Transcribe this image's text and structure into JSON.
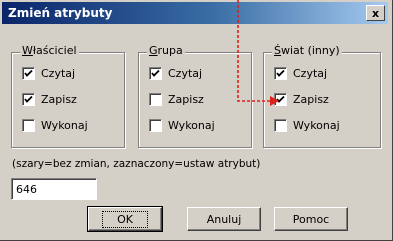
{
  "dialog": {
    "title": "Zmień atrybuty",
    "close_label": "x"
  },
  "groups": [
    {
      "legend_mnemonic": "W",
      "legend_rest": "łaściciel",
      "items": [
        {
          "label": "Czytaj",
          "checked": true
        },
        {
          "label": "Zapisz",
          "checked": true
        },
        {
          "label": "Wykonaj",
          "checked": false
        }
      ]
    },
    {
      "legend_mnemonic": "G",
      "legend_rest": "rupa",
      "items": [
        {
          "label": "Czytaj",
          "checked": true
        },
        {
          "label": "Zapisz",
          "checked": false
        },
        {
          "label": "Wykonaj",
          "checked": false
        }
      ]
    },
    {
      "legend_mnemonic": "Ś",
      "legend_rest": "wiat (inny)",
      "items": [
        {
          "label": "Czytaj",
          "checked": true
        },
        {
          "label": "Zapisz",
          "checked": true
        },
        {
          "label": "Wykonaj",
          "checked": false
        }
      ]
    }
  ],
  "hint": "(szary=bez zmian, zaznaczony=ustaw atrybut)",
  "value_field": {
    "value": "646"
  },
  "buttons": {
    "ok": "OK",
    "cancel": "Anuluj",
    "help": "Pomoc"
  },
  "colors": {
    "annotation_arrow": "#e0201b",
    "background": "#f3cf3f"
  }
}
